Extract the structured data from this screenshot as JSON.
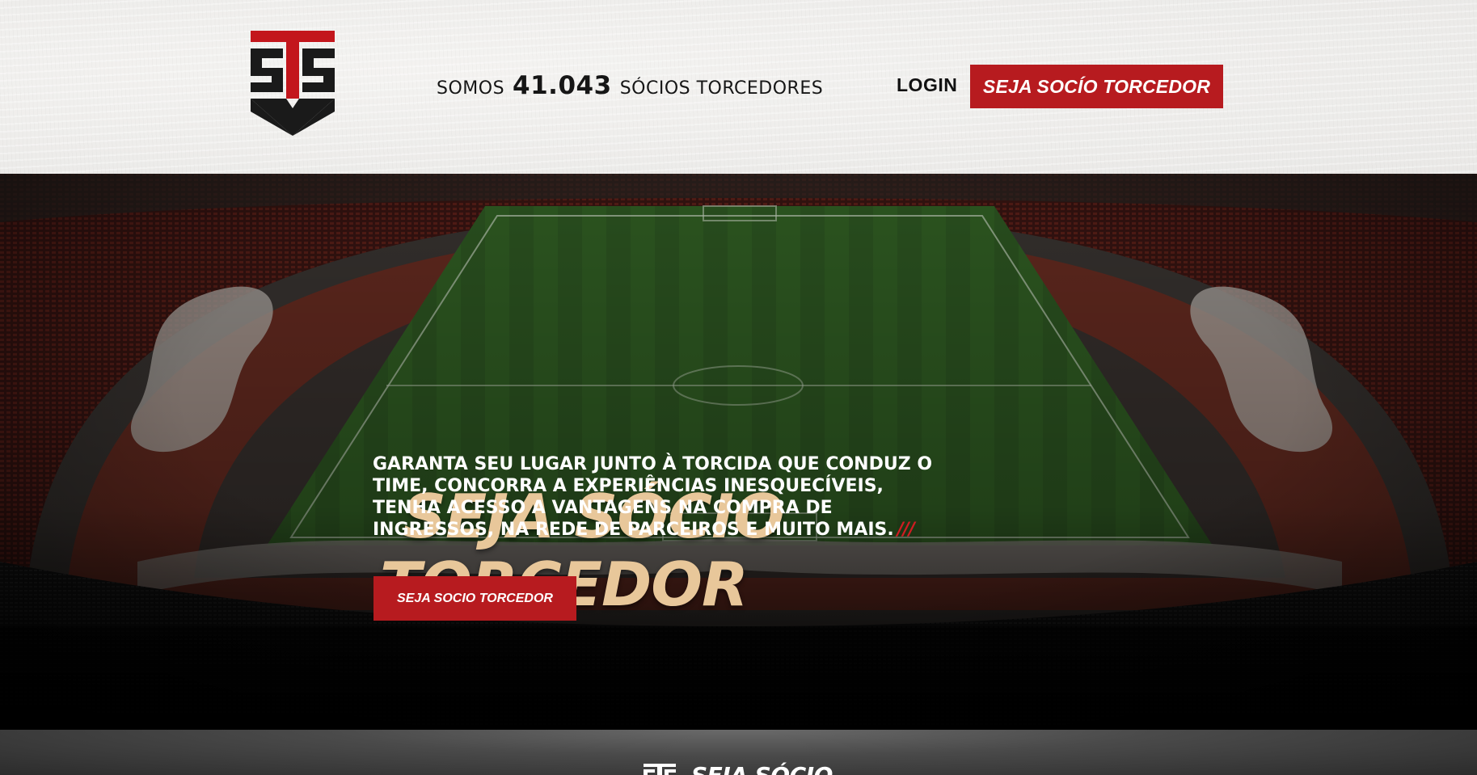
{
  "header": {
    "members_prefix": "SOMOS",
    "members_count": "41.043",
    "members_suffix": "SÓCIOS TORCEDORES",
    "login_label": "LOGIN",
    "cta_label": "SEJA SOCÍO TORCEDOR"
  },
  "hero": {
    "title_line1": "SEJA SÓCIO",
    "title_line2": "TORCEDOR",
    "description": "GARANTA SEU LUGAR JUNTO À TORCIDA QUE CONDUZ O TIME, CONCORRA A EXPERIÊNCIAS INESQUECÍVEIS, TENHA ACESSO A VANTAGENS NA COMPRA DE INGRESSOS, NA REDE DE PARCEIROS E MUITO MAIS.",
    "slashes": "///",
    "cta_label": "SEJA SOCIO TORCEDOR"
  },
  "next_section": {
    "title": "SEJA SÓCIO"
  },
  "colors": {
    "brand_red": "#b71b1f",
    "title_gold": "#e8c79a",
    "header_bg": "#efeeec"
  },
  "icons": {
    "logo": "club-shield-logo-icon"
  }
}
